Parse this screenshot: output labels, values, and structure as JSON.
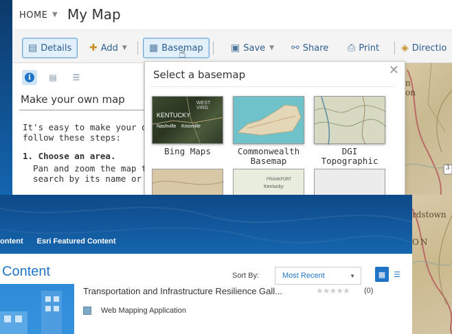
{
  "header": {
    "home_label": "HOME",
    "map_title": "My Map"
  },
  "toolbar": {
    "details_label": "Details",
    "add_label": "Add",
    "basemap_label": "Basemap",
    "save_label": "Save",
    "share_label": "Share",
    "print_label": "Print",
    "directions_label": "Directio"
  },
  "panel": {
    "heading": "Make your own map",
    "intro": "It's easy to make your own\nfollow these steps:",
    "step1_title": "1. Choose an area.",
    "step1_desc": "Pan and zoom the map to\nsearch by its name or add"
  },
  "basemap_popup": {
    "title": "Select a basemap",
    "close_glyph": "✕",
    "items": [
      {
        "label": "Bing Maps",
        "thumb_text_1": "KENTUCKY",
        "thumb_text_2": "WEST VIRG",
        "thumb_text_3": "Nashville",
        "thumb_text_4": "Knoxville"
      },
      {
        "label": "Commonwealth\nBasemap"
      },
      {
        "label": "DGI\nTopographic"
      },
      {
        "label": ""
      },
      {
        "label": "",
        "thumb_text_1": "FRANKFORT",
        "thumb_text_2": "Kentucky"
      },
      {
        "label": ""
      }
    ]
  },
  "map": {
    "label_top_1": "n",
    "label_top_2": "on",
    "label_mid": "rdstown",
    "label_on": "ON",
    "road_badge": "3"
  },
  "content_page": {
    "nav_items": [
      "ontent",
      "Esri Featured Content"
    ],
    "title": "Content",
    "sort_by_label": "Sort By:",
    "sort_value": "Most Recent",
    "item_title": "Transportation and Infrastructure Resilience Gall...",
    "item_stars": "★★★★★",
    "item_count": "(0)",
    "item_type": "Web Mapping Application"
  },
  "colors": {
    "accent_blue": "#1e74c6",
    "header_blue": "#1565ae",
    "toolbar_text": "#2d5d8f"
  }
}
